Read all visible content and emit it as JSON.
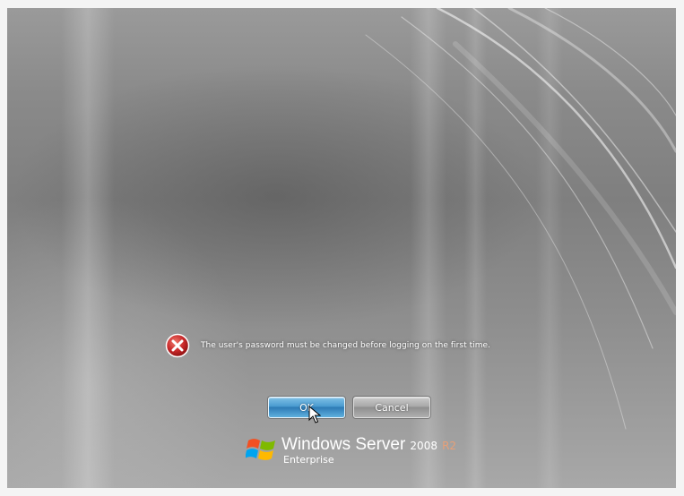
{
  "error": {
    "icon": "error-x-icon",
    "message": "The user's password must be changed before logging on the first time."
  },
  "buttons": {
    "ok_label": "OK",
    "cancel_label": "Cancel"
  },
  "branding": {
    "product": "Windows Server",
    "version": "2008",
    "release": "R2",
    "edition": "Enterprise"
  },
  "colors": {
    "ok_button": "#4a9bd0",
    "error_icon": "#c8282a",
    "background": "#8a8a8a"
  }
}
